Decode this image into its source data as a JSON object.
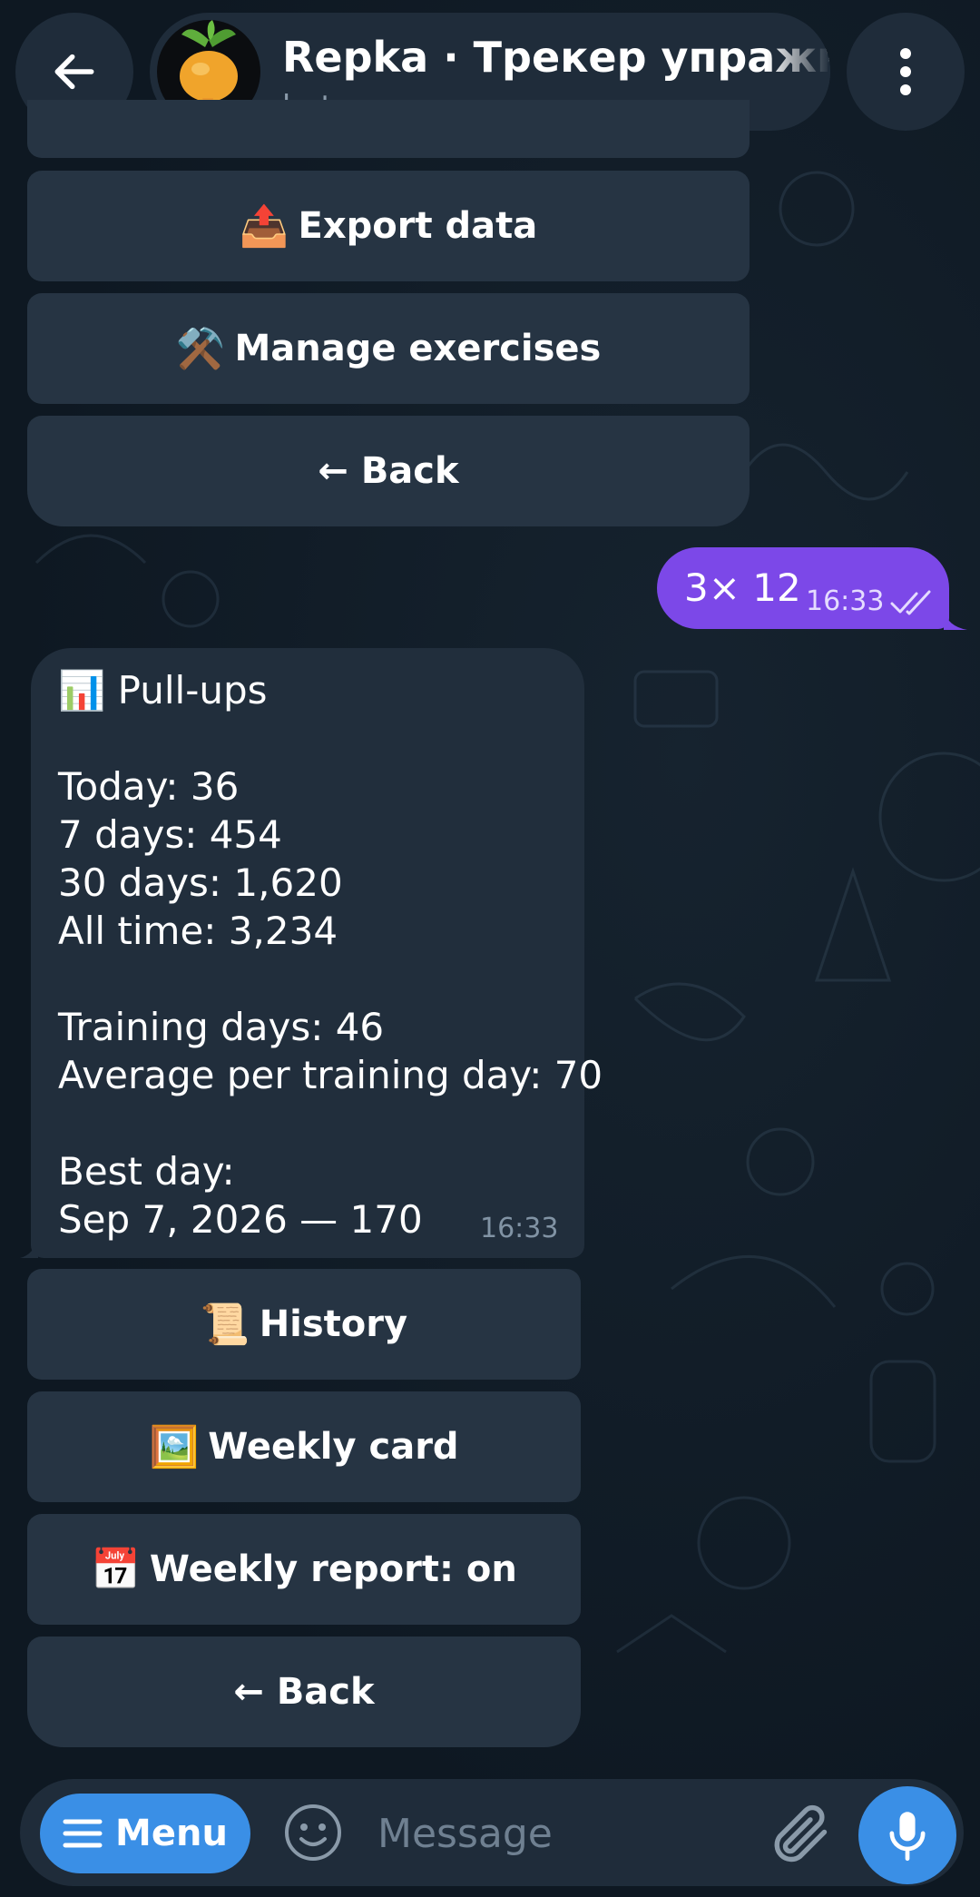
{
  "header": {
    "title": "Repka · Трекер упражнен",
    "subtitle": "bot",
    "back_icon": "arrow-left-icon",
    "menu_icon": "more-vertical-icon",
    "avatar_icon": "turnip-icon"
  },
  "top_keyboard": [
    {
      "emoji": "📤",
      "label": "Export data"
    },
    {
      "emoji": "⚒️",
      "label": "Manage exercises"
    },
    {
      "emoji": "",
      "label": "← Back"
    }
  ],
  "outgoing_message": {
    "text": "3× 12",
    "time": "16:33",
    "status_icon": "double-check-icon"
  },
  "incoming_message": {
    "emoji": "📊",
    "title": "Pull-ups",
    "lines": [
      "Today: 36",
      "7 days: 454",
      "30 days: 1,620",
      "All time: 3,234",
      "Training days: 46",
      "Average per training day: 70",
      "Best day:",
      "Sep 7, 2026 — 170"
    ],
    "time": "16:33"
  },
  "bottom_keyboard": [
    {
      "emoji": "📜",
      "label": "History"
    },
    {
      "emoji": "🖼️",
      "label": "Weekly card"
    },
    {
      "emoji": "📅",
      "label": "Weekly report: on"
    },
    {
      "emoji": "",
      "label": "← Back"
    }
  ],
  "input_bar": {
    "menu_label": "Menu",
    "placeholder": "Message",
    "emoji_icon": "smiley-icon",
    "attach_icon": "paperclip-icon",
    "mic_icon": "microphone-icon"
  },
  "colors": {
    "accent": "#3a8fe6",
    "outgoing_bubble": "#7c48e8",
    "incoming_bubble": "#212e3c",
    "keyboard_button": "#263443"
  }
}
